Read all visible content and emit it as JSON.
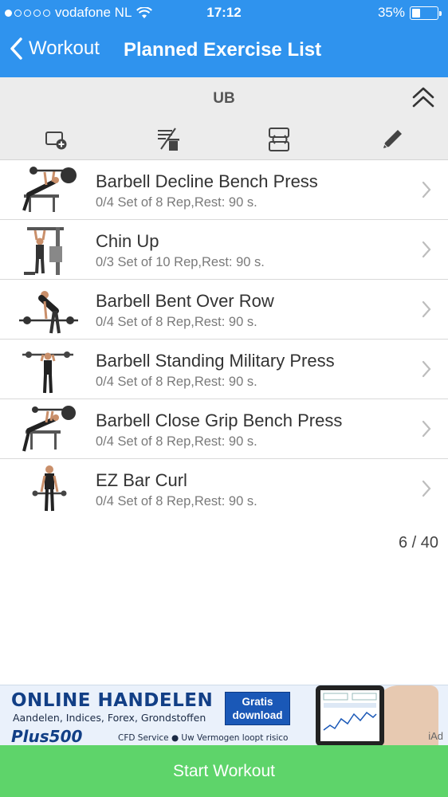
{
  "status_bar": {
    "carrier": "vodafone NL",
    "time": "17:12",
    "battery": "35%",
    "battery_level": 0.35,
    "signal_bars_filled": 1,
    "signal_bars_total": 5
  },
  "nav": {
    "back_label": "Workout",
    "title": "Planned Exercise List"
  },
  "group": {
    "title": "UB",
    "toolbar": [
      "add-exercise-icon",
      "remove-exercise-icon",
      "reorder-icon",
      "edit-icon"
    ]
  },
  "exercises": [
    {
      "name": "Barbell Decline Bench Press",
      "detail": "0/4 Set of 8 Rep,Rest: 90 s."
    },
    {
      "name": "Chin Up",
      "detail": "0/3 Set of 10 Rep,Rest: 90 s."
    },
    {
      "name": "Barbell Bent Over Row",
      "detail": "0/4 Set of 8 Rep,Rest: 90 s."
    },
    {
      "name": "Barbell Standing Military Press",
      "detail": "0/4 Set of 8 Rep,Rest: 90 s."
    },
    {
      "name": "Barbell Close Grip Bench Press",
      "detail": "0/4 Set of 8 Rep,Rest: 90 s."
    },
    {
      "name": "EZ Bar Curl",
      "detail": "0/4 Set of 8 Rep,Rest: 90 s."
    }
  ],
  "count": "6 / 40",
  "ad": {
    "headline": "ONLINE HANDELEN",
    "subline": "Aandelen, Indices, Forex, Grondstoffen",
    "brand": "Plus500",
    "disclaimer": "CFD Service ● Uw Vermogen loopt risico",
    "button": "Gratis download",
    "badge": "iAd"
  },
  "start_button": "Start Workout",
  "colors": {
    "nav_blue": "#2f93ee",
    "start_green": "#5ed46a",
    "group_gray": "#ececec"
  }
}
